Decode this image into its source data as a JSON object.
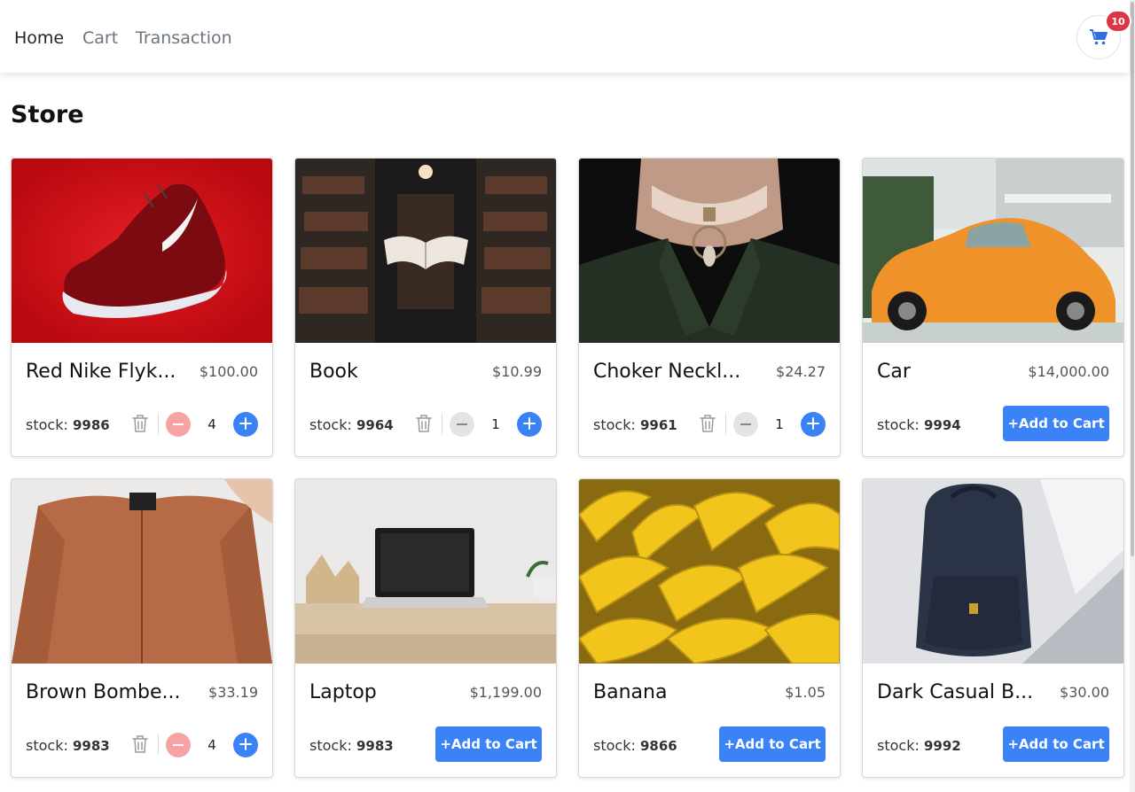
{
  "nav": {
    "links": [
      "Home",
      "Cart",
      "Transaction"
    ],
    "cart_count": "10"
  },
  "page": {
    "title": "Store"
  },
  "colors": {
    "accent": "#3b82f6",
    "badge": "#dc3545",
    "minus_active": "#f5a3a3"
  },
  "products": [
    {
      "name": "Red Nike Flyk...",
      "price": "$100.00",
      "stock_label": "stock:",
      "stock": "9986",
      "in_cart": true,
      "qty": "4",
      "minus_enabled": true,
      "image": "red-nike-shoe"
    },
    {
      "name": "Book",
      "price": "$10.99",
      "stock_label": "stock:",
      "stock": "9964",
      "in_cart": true,
      "qty": "1",
      "minus_enabled": false,
      "image": "book-library"
    },
    {
      "name": "Choker Neckl...",
      "price": "$24.27",
      "stock_label": "stock:",
      "stock": "9961",
      "in_cart": true,
      "qty": "1",
      "minus_enabled": false,
      "image": "choker-necklace"
    },
    {
      "name": "Car",
      "price": "$14,000.00",
      "stock_label": "stock:",
      "stock": "9994",
      "in_cart": false,
      "add_label": "+Add to Cart",
      "image": "orange-beetle-car"
    },
    {
      "name": "Brown Bombe...",
      "price": "$33.19",
      "stock_label": "stock:",
      "stock": "9983",
      "in_cart": true,
      "qty": "4",
      "minus_enabled": true,
      "image": "brown-bomber-jacket"
    },
    {
      "name": "Laptop",
      "price": "$1,199.00",
      "stock_label": "stock:",
      "stock": "9983",
      "in_cart": false,
      "add_label": "+Add to Cart",
      "image": "laptop-desk"
    },
    {
      "name": "Banana",
      "price": "$1.05",
      "stock_label": "stock:",
      "stock": "9866",
      "in_cart": false,
      "add_label": "+Add to Cart",
      "image": "bananas"
    },
    {
      "name": "Dark Casual B...",
      "price": "$30.00",
      "stock_label": "stock:",
      "stock": "9992",
      "in_cart": false,
      "add_label": "+Add to Cart",
      "image": "dark-backpack"
    }
  ]
}
